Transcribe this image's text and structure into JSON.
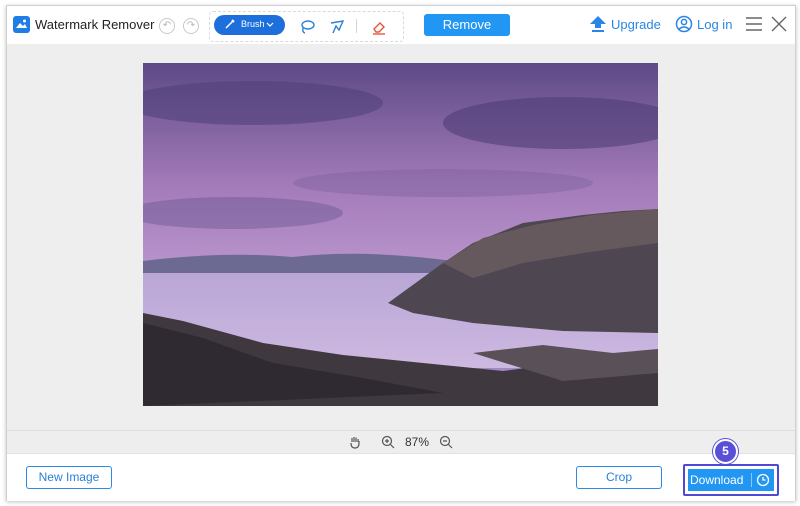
{
  "app": {
    "title": "Watermark Remover",
    "logo_icon": "image-icon",
    "accent": "#2196f3"
  },
  "toolbar": {
    "undo_icon": "undo-icon",
    "redo_icon": "redo-icon",
    "brush_label": "Brush",
    "brush_icon": "brush-icon",
    "brush_dropdown_icon": "chevron-down-icon",
    "lasso_icon": "lasso-icon",
    "polygon_icon": "polygonal-lasso-icon",
    "eraser_icon": "eraser-icon",
    "remove_label": "Remove"
  },
  "header": {
    "upgrade_label": "Upgrade",
    "upgrade_icon": "upload-arrow-icon",
    "login_label": "Log in",
    "login_icon": "user-circle-icon",
    "menu_icon": "hamburger-menu-icon",
    "close_icon": "close-icon"
  },
  "canvas": {
    "image": "landscape-photo"
  },
  "zoom": {
    "hand_icon": "hand-icon",
    "zoom_in_icon": "zoom-in-icon",
    "value": "87%",
    "zoom_out_icon": "zoom-out-icon"
  },
  "footer": {
    "new_image_label": "New Image",
    "crop_label": "Crop",
    "download_label": "Download",
    "download_icon": "clock-icon",
    "step_badge": "5",
    "step_badge_color": "#5a4fd8"
  }
}
